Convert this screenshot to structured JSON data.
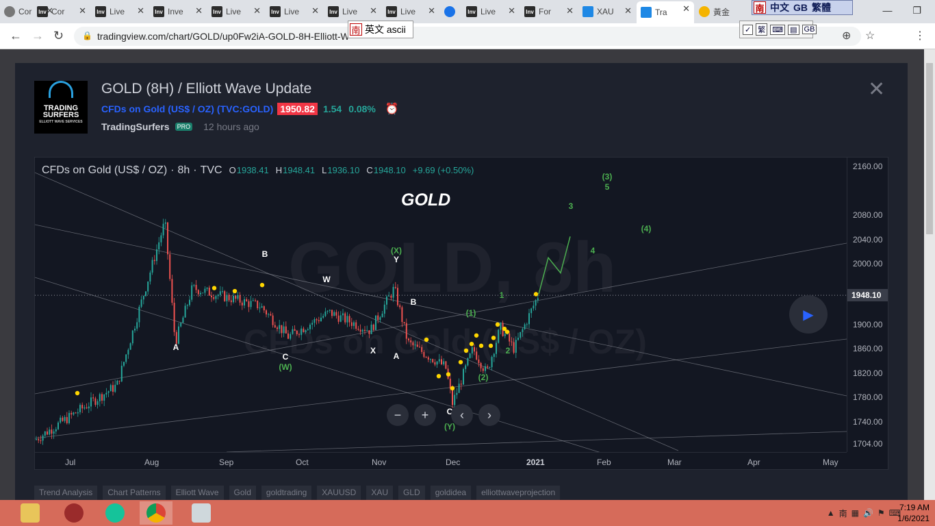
{
  "browser": {
    "tabs": [
      {
        "label": "Cor",
        "favicon": "Inv"
      },
      {
        "label": "Live",
        "favicon": "Inv"
      },
      {
        "label": "Inve",
        "favicon": "Inv"
      },
      {
        "label": "Live",
        "favicon": "Inv"
      },
      {
        "label": "Live",
        "favicon": "Inv"
      },
      {
        "label": "Live",
        "favicon": "Inv"
      },
      {
        "label": "Live",
        "favicon": "Inv"
      },
      {
        "label": "Live",
        "favicon": "Inv"
      },
      {
        "label": "For",
        "favicon": "Inv"
      },
      {
        "label": "XAU",
        "favicon": "tv"
      },
      {
        "label": "Tra",
        "favicon": "tv"
      },
      {
        "label": "黃金",
        "favicon": "gem"
      }
    ],
    "url": "tradingview.com/chart/GOLD/up0Fw2iA-GOLD-8H-Elliott-W",
    "avatar_letter": "J"
  },
  "ime": {
    "bar_text_1": "中文",
    "bar_text_2": "GB",
    "bar_text_3": "繁體",
    "input_logo": "南",
    "input_text": "英文 ascii",
    "tool_trad": "繁"
  },
  "idea": {
    "title": "GOLD (8H) / Elliott Wave Update",
    "symbol_name": "CFDs on Gold (US$ / OZ)",
    "symbol_code": "(TVC:GOLD)",
    "price": "1950.82",
    "change": "1.54",
    "change_pct": "0.08%",
    "author": "TradingSurfers",
    "badge": "PRO",
    "time_ago": "12 hours ago",
    "logo_line1": "TRADING",
    "logo_line2": "SURFERS",
    "logo_line3": "ELLIOTT WAVE SERVICES"
  },
  "chart_legend": {
    "symbol": "CFDs on Gold (US$ / OZ)",
    "interval": "8h",
    "exchange": "TVC",
    "o_label": "O",
    "o": "1938.41",
    "h_label": "H",
    "h": "1948.41",
    "l_label": "L",
    "l": "1936.10",
    "c_label": "C",
    "c": "1948.10",
    "change": "+9.69 (+0.50%)",
    "overlay_title": "GOLD",
    "watermark_1": "GOLD, 8h",
    "watermark_2": "CFDs on Gold (US$ / OZ)"
  },
  "chart_data": {
    "type": "line",
    "x": [
      "Jul",
      "Aug",
      "Sep",
      "Oct",
      "Nov",
      "Dec",
      "2021",
      "Feb",
      "Mar",
      "Apr",
      "May"
    ],
    "series": [
      {
        "values": [
          1770,
          1960,
          1960,
          1880,
          1960,
          1770,
          1900,
          2010,
          null,
          null,
          null
        ]
      }
    ],
    "y_ticks": [
      "2160.00",
      "2080.00",
      "2040.00",
      "2000.00",
      "1948.10",
      "1900.00",
      "1860.00",
      "1820.00",
      "1780.00",
      "1740.00",
      "1704.00"
    ],
    "current_price": "1948.10",
    "y_range": [
      1690,
      2175
    ],
    "wave_labels": [
      "A",
      "B",
      "C",
      "(W)",
      "W",
      "X",
      "(X)",
      "Y",
      "A",
      "B",
      "C",
      "(Y)",
      "(1)",
      "(2)",
      "1",
      "2",
      "3",
      "4",
      "(3)",
      "5",
      "(4)"
    ],
    "grid": false
  },
  "chart_controls": {
    "zoom_out": "−",
    "zoom_in": "+",
    "prev": "‹",
    "next": "›"
  },
  "tags": [
    "Trend Analysis",
    "Chart Patterns",
    "Elliott Wave",
    "Gold",
    "goldtrading",
    "XAUUSD",
    "XAU",
    "GLD",
    "goldidea",
    "elliottwaveprojection"
  ],
  "taskbar": {
    "time": "7:19 AM",
    "date": "1/6/2021"
  },
  "colors": {
    "price_red": "#f23645",
    "up_green": "#26a69a",
    "wave_green": "#4caf50",
    "marker_yellow": "#ffd600"
  }
}
